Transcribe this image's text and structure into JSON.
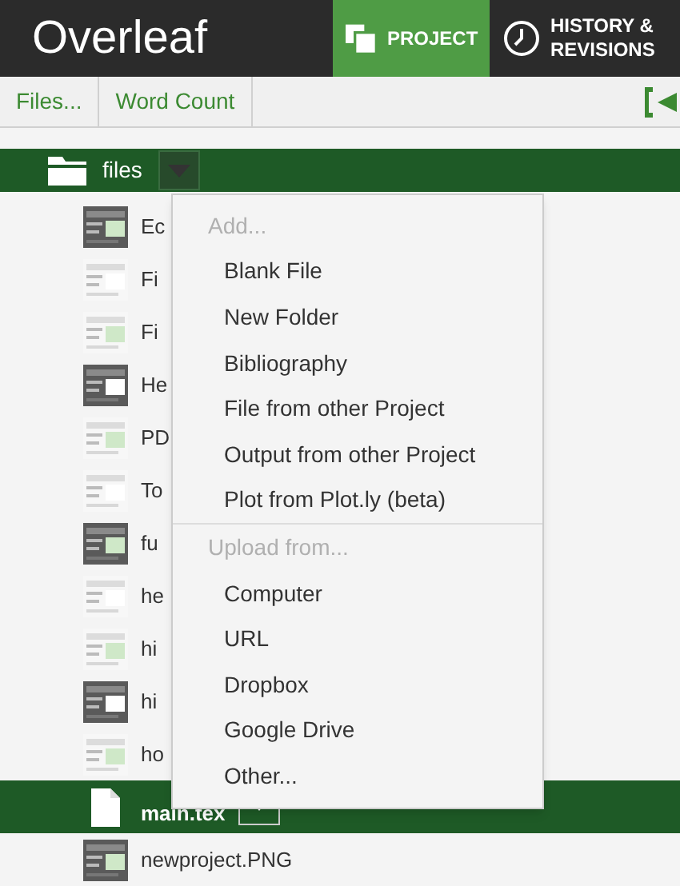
{
  "header": {
    "logo": "Overleaf",
    "tabs": [
      {
        "label": "PROJECT",
        "selected": true,
        "kind": "project"
      },
      {
        "label": "HISTORY &",
        "label_2": "REVISIONS",
        "selected": false,
        "kind": "history"
      }
    ]
  },
  "toolbar": {
    "items": [
      "Files...",
      "Word Count"
    ]
  },
  "folder": {
    "name": "files"
  },
  "files": [
    {
      "name": "Ec",
      "kind": "picture",
      "selected": false
    },
    {
      "name": "Fi",
      "kind": "picture",
      "selected": false
    },
    {
      "name": "Fi",
      "kind": "picture",
      "selected": false
    },
    {
      "name": "He",
      "kind": "picture",
      "selected": false
    },
    {
      "name": "PD",
      "kind": "picture",
      "selected": false
    },
    {
      "name": "To",
      "kind": "picture",
      "selected": false
    },
    {
      "name": "fu",
      "kind": "picture",
      "selected": false
    },
    {
      "name": "he",
      "kind": "picture",
      "selected": false
    },
    {
      "name": "hi",
      "kind": "picture",
      "selected": false
    },
    {
      "name": "hi",
      "kind": "picture",
      "selected": false
    },
    {
      "name": "ho",
      "kind": "picture",
      "selected": false
    },
    {
      "name": "main.tex",
      "kind": "document",
      "selected": true
    },
    {
      "name": "newproject.PNG",
      "kind": "picture",
      "selected": false
    }
  ],
  "menu": {
    "items": [
      {
        "label": "Add...",
        "kind": "header"
      },
      {
        "label": "Blank File",
        "kind": "item"
      },
      {
        "label": "New Folder",
        "kind": "item"
      },
      {
        "label": "Bibliography",
        "kind": "item"
      },
      {
        "label": "File from other Project",
        "kind": "item"
      },
      {
        "label": "Output from other Project",
        "kind": "item"
      },
      {
        "label": "Plot from Plot.ly (beta)",
        "kind": "item"
      },
      {
        "label": "Upload from...",
        "kind": "header",
        "divider": true
      },
      {
        "label": "Computer",
        "kind": "item"
      },
      {
        "label": "URL",
        "kind": "item"
      },
      {
        "label": "Dropbox",
        "kind": "item"
      },
      {
        "label": "Google Drive",
        "kind": "item"
      },
      {
        "label": "Other...",
        "kind": "item"
      }
    ]
  }
}
